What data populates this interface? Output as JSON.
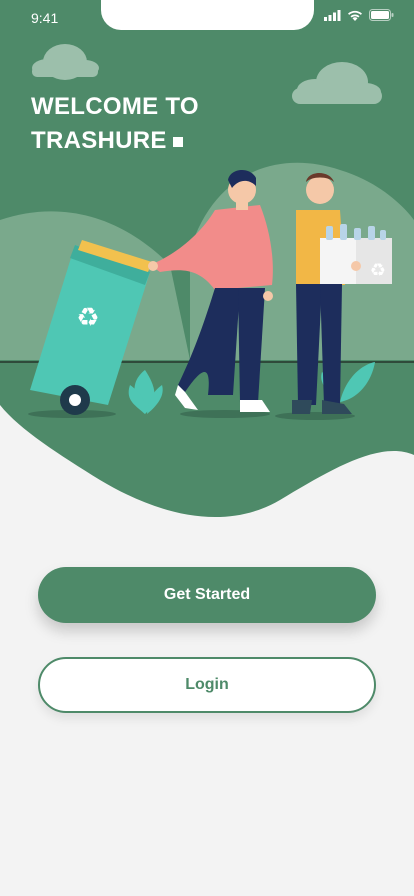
{
  "status_bar": {
    "time": "9:41"
  },
  "welcome": {
    "line1": "WELCOME TO",
    "line2": "TRASHURE"
  },
  "buttons": {
    "get_started": "Get Started",
    "login": "Login"
  },
  "colors": {
    "primary": "#4e8a69",
    "background": "#f3f3f3",
    "hill": "#7aa98c",
    "bin": "#4fc7b4"
  }
}
